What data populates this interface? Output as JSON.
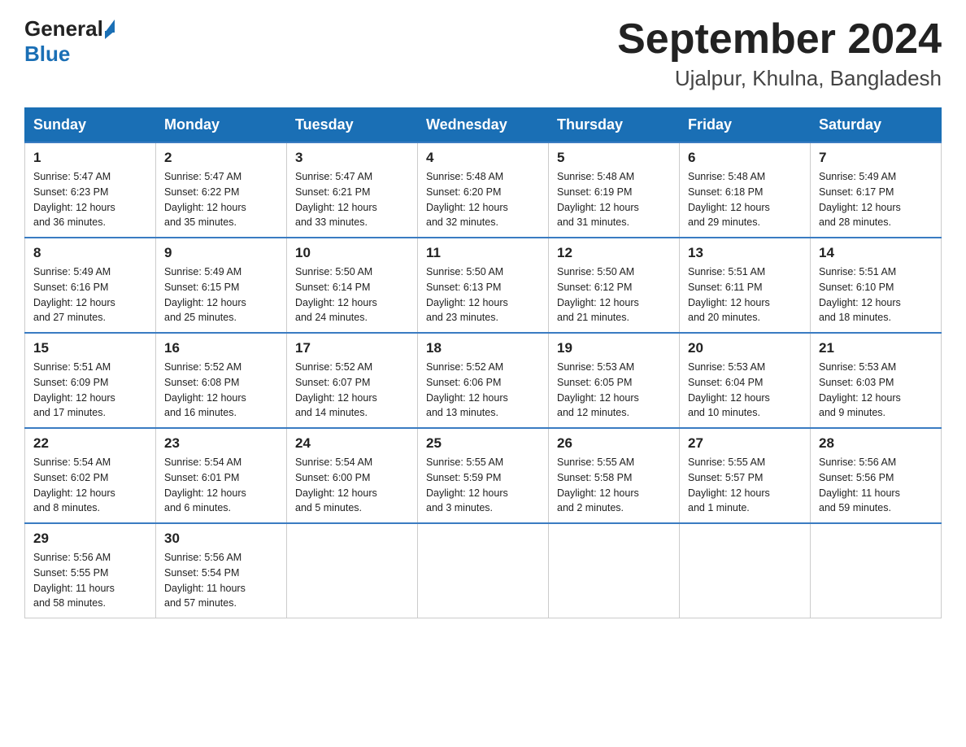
{
  "logo": {
    "text_general": "General",
    "text_blue": "Blue"
  },
  "title": "September 2024",
  "subtitle": "Ujalpur, Khulna, Bangladesh",
  "days_of_week": [
    "Sunday",
    "Monday",
    "Tuesday",
    "Wednesday",
    "Thursday",
    "Friday",
    "Saturday"
  ],
  "weeks": [
    [
      {
        "day": "1",
        "sunrise": "5:47 AM",
        "sunset": "6:23 PM",
        "daylight": "12 hours and 36 minutes."
      },
      {
        "day": "2",
        "sunrise": "5:47 AM",
        "sunset": "6:22 PM",
        "daylight": "12 hours and 35 minutes."
      },
      {
        "day": "3",
        "sunrise": "5:47 AM",
        "sunset": "6:21 PM",
        "daylight": "12 hours and 33 minutes."
      },
      {
        "day": "4",
        "sunrise": "5:48 AM",
        "sunset": "6:20 PM",
        "daylight": "12 hours and 32 minutes."
      },
      {
        "day": "5",
        "sunrise": "5:48 AM",
        "sunset": "6:19 PM",
        "daylight": "12 hours and 31 minutes."
      },
      {
        "day": "6",
        "sunrise": "5:48 AM",
        "sunset": "6:18 PM",
        "daylight": "12 hours and 29 minutes."
      },
      {
        "day": "7",
        "sunrise": "5:49 AM",
        "sunset": "6:17 PM",
        "daylight": "12 hours and 28 minutes."
      }
    ],
    [
      {
        "day": "8",
        "sunrise": "5:49 AM",
        "sunset": "6:16 PM",
        "daylight": "12 hours and 27 minutes."
      },
      {
        "day": "9",
        "sunrise": "5:49 AM",
        "sunset": "6:15 PM",
        "daylight": "12 hours and 25 minutes."
      },
      {
        "day": "10",
        "sunrise": "5:50 AM",
        "sunset": "6:14 PM",
        "daylight": "12 hours and 24 minutes."
      },
      {
        "day": "11",
        "sunrise": "5:50 AM",
        "sunset": "6:13 PM",
        "daylight": "12 hours and 23 minutes."
      },
      {
        "day": "12",
        "sunrise": "5:50 AM",
        "sunset": "6:12 PM",
        "daylight": "12 hours and 21 minutes."
      },
      {
        "day": "13",
        "sunrise": "5:51 AM",
        "sunset": "6:11 PM",
        "daylight": "12 hours and 20 minutes."
      },
      {
        "day": "14",
        "sunrise": "5:51 AM",
        "sunset": "6:10 PM",
        "daylight": "12 hours and 18 minutes."
      }
    ],
    [
      {
        "day": "15",
        "sunrise": "5:51 AM",
        "sunset": "6:09 PM",
        "daylight": "12 hours and 17 minutes."
      },
      {
        "day": "16",
        "sunrise": "5:52 AM",
        "sunset": "6:08 PM",
        "daylight": "12 hours and 16 minutes."
      },
      {
        "day": "17",
        "sunrise": "5:52 AM",
        "sunset": "6:07 PM",
        "daylight": "12 hours and 14 minutes."
      },
      {
        "day": "18",
        "sunrise": "5:52 AM",
        "sunset": "6:06 PM",
        "daylight": "12 hours and 13 minutes."
      },
      {
        "day": "19",
        "sunrise": "5:53 AM",
        "sunset": "6:05 PM",
        "daylight": "12 hours and 12 minutes."
      },
      {
        "day": "20",
        "sunrise": "5:53 AM",
        "sunset": "6:04 PM",
        "daylight": "12 hours and 10 minutes."
      },
      {
        "day": "21",
        "sunrise": "5:53 AM",
        "sunset": "6:03 PM",
        "daylight": "12 hours and 9 minutes."
      }
    ],
    [
      {
        "day": "22",
        "sunrise": "5:54 AM",
        "sunset": "6:02 PM",
        "daylight": "12 hours and 8 minutes."
      },
      {
        "day": "23",
        "sunrise": "5:54 AM",
        "sunset": "6:01 PM",
        "daylight": "12 hours and 6 minutes."
      },
      {
        "day": "24",
        "sunrise": "5:54 AM",
        "sunset": "6:00 PM",
        "daylight": "12 hours and 5 minutes."
      },
      {
        "day": "25",
        "sunrise": "5:55 AM",
        "sunset": "5:59 PM",
        "daylight": "12 hours and 3 minutes."
      },
      {
        "day": "26",
        "sunrise": "5:55 AM",
        "sunset": "5:58 PM",
        "daylight": "12 hours and 2 minutes."
      },
      {
        "day": "27",
        "sunrise": "5:55 AM",
        "sunset": "5:57 PM",
        "daylight": "12 hours and 1 minute."
      },
      {
        "day": "28",
        "sunrise": "5:56 AM",
        "sunset": "5:56 PM",
        "daylight": "11 hours and 59 minutes."
      }
    ],
    [
      {
        "day": "29",
        "sunrise": "5:56 AM",
        "sunset": "5:55 PM",
        "daylight": "11 hours and 58 minutes."
      },
      {
        "day": "30",
        "sunrise": "5:56 AM",
        "sunset": "5:54 PM",
        "daylight": "11 hours and 57 minutes."
      },
      null,
      null,
      null,
      null,
      null
    ]
  ],
  "labels": {
    "sunrise": "Sunrise:",
    "sunset": "Sunset:",
    "daylight": "Daylight:"
  }
}
